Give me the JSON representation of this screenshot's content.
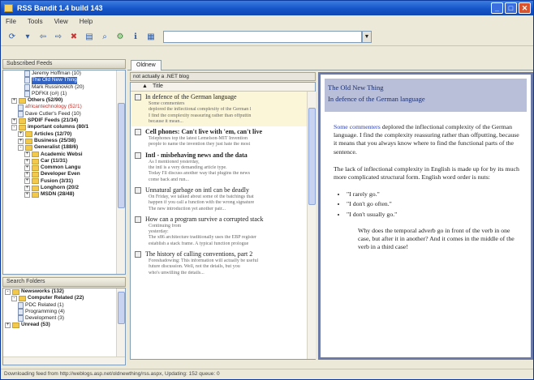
{
  "window": {
    "title": "RSS Bandit 1.4 build 143"
  },
  "menu": [
    "File",
    "Tools",
    "View",
    "Help"
  ],
  "toolbar": {
    "icons": [
      "refresh-icon",
      "dropdown-icon",
      "back-icon",
      "forward-icon",
      "stop-icon",
      "new-feed-icon",
      "search-icon",
      "options-icon",
      "info-icon",
      "go-icon"
    ],
    "url_value": ""
  },
  "feeds_pane": {
    "title": "Subscribed Feeds",
    "rows": [
      {
        "indent": 3,
        "type": "feed",
        "label": "Jeremy Hoffman (10)",
        "style": ""
      },
      {
        "indent": 3,
        "type": "feed",
        "label": "The Old New Thing",
        "style": "sel"
      },
      {
        "indent": 3,
        "type": "feed",
        "label": "Mark Russinovich (20)",
        "style": ""
      },
      {
        "indent": 3,
        "type": "feed",
        "label": "PDFKit (c#) (1)",
        "style": ""
      },
      {
        "indent": 1,
        "type": "folder",
        "exp": "+",
        "label": "Others (52/90)",
        "style": "bold"
      },
      {
        "indent": 2,
        "type": "feed",
        "label": "africantechnology (52/1)",
        "style": "red"
      },
      {
        "indent": 2,
        "type": "feed",
        "label": "Dave Cutler's Feed (10)",
        "style": ""
      },
      {
        "indent": 1,
        "type": "folder",
        "exp": "+",
        "label": "SPDIF Feeds (21/34)",
        "style": "bold"
      },
      {
        "indent": 1,
        "type": "folder",
        "exp": "-",
        "label": "important columns (80/1",
        "style": "bold"
      },
      {
        "indent": 2,
        "type": "folder",
        "exp": "+",
        "label": "Articles (12/70)",
        "style": "bold"
      },
      {
        "indent": 2,
        "type": "folder",
        "exp": "+",
        "label": "Business (25/38)",
        "style": "bold"
      },
      {
        "indent": 2,
        "type": "folder",
        "exp": "-",
        "label": "Generalist (188/6)",
        "style": "bold"
      },
      {
        "indent": 3,
        "type": "folder",
        "exp": "+",
        "label": "Academic Websi",
        "style": "bold"
      },
      {
        "indent": 3,
        "type": "folder",
        "exp": "+",
        "label": "Car (11/31)",
        "style": "bold"
      },
      {
        "indent": 3,
        "type": "folder",
        "exp": "+",
        "label": "Common Langu",
        "style": "bold"
      },
      {
        "indent": 3,
        "type": "folder",
        "exp": "+",
        "label": "Developer Even",
        "style": "bold"
      },
      {
        "indent": 3,
        "type": "folder",
        "exp": "+",
        "label": "Fusion (3/31)",
        "style": "bold"
      },
      {
        "indent": 3,
        "type": "folder",
        "exp": "+",
        "label": "Longhorn (20/2",
        "style": "bold"
      },
      {
        "indent": 3,
        "type": "folder",
        "exp": "+",
        "label": "MSDN (28/48)",
        "style": "bold"
      }
    ]
  },
  "search_pane": {
    "title": "Search Folders",
    "rows": [
      {
        "indent": 0,
        "type": "folder",
        "exp": "-",
        "label": "Newsworks (132)",
        "style": "bold"
      },
      {
        "indent": 1,
        "type": "folder",
        "exp": "-",
        "label": "Computer Related (22)",
        "style": "bold"
      },
      {
        "indent": 2,
        "type": "feed",
        "label": "PDC Related (1)",
        "style": ""
      },
      {
        "indent": 2,
        "type": "feed",
        "label": "Programming (4)",
        "style": ""
      },
      {
        "indent": 2,
        "type": "feed",
        "label": "Development (3)",
        "style": ""
      },
      {
        "indent": 0,
        "type": "folder",
        "exp": "+",
        "label": "Unread (53)",
        "style": "bold"
      }
    ]
  },
  "tab": {
    "label": "Oldnew"
  },
  "list": {
    "header": "not actually a .NET blog",
    "column_title": "Title",
    "items": [
      {
        "title": "In defence of the German language",
        "bold": false,
        "selected": true,
        "snippet": [
          "Some commenters",
          "deplored the inflectional complexity of the German l",
          "I find the complexity reassuring rather than offputtin",
          "because it mean..."
        ]
      },
      {
        "title": "Cell phones: Can't live with 'em, can't live",
        "bold": true,
        "selected": false,
        "snippet": [
          "Telephones top the latest Lemelson-MIT Invention",
          "people to name the invention they just hate the most"
        ]
      },
      {
        "title": "Intl - misbehaving news and the data",
        "bold": true,
        "selected": false,
        "snippet": [
          "As I mentioned yesterday,",
          "the intl is a very demanding article type.",
          "Today I'll discuss another way that plugins the news",
          "come back and run..."
        ]
      },
      {
        "title": "Unnatural garbage on intl can be deadly",
        "bold": false,
        "selected": false,
        "snippet": [
          "On Friday, we talked about some of the batchings that",
          "happen if you call a function with the wrong signature",
          "The new introduction yet another pair..."
        ]
      },
      {
        "title": "How can a program survive a corrupted stack",
        "bold": false,
        "selected": false,
        "snippet": [
          "Continuing from",
          "yesterday:",
          "The x86 architecture traditionally uses the EBP register",
          "establish a stack frame. A typical function prologue"
        ]
      },
      {
        "title": "The history of calling conventions, part 2",
        "bold": false,
        "selected": false,
        "snippet": [
          "Foreshadowing: This information will actually be useful",
          "future discussion. Well, not the details, but you",
          "who's unwilling the details..."
        ]
      }
    ]
  },
  "reader": {
    "feed_title": "The Old New Thing",
    "item_title": "In defence of the German language",
    "link_text": "Some commenters",
    "p1_rest": " deplored the inflectional complexity of the German language. I find the complexity reassuring rather than offputting, because it means that you always know where to find the functional parts of the sentence.",
    "p2": "The lack of inflectional complexity in English is made up for by its much more complicated structural form. English word order is nuts:",
    "bullets": [
      "\"I rarely go.\"",
      "\"I don't go often.\"",
      "\"I don't usually go.\""
    ],
    "p3": "Why does the temporal adverb go in front of the verb in one case, but after it in another? And it comes in the middle of the verb in a third case!"
  },
  "status": {
    "text": "Downloading feed from http://weblogs.asp.net/oldnewthing/rss.aspx, Updating: 152 queue: 0"
  }
}
